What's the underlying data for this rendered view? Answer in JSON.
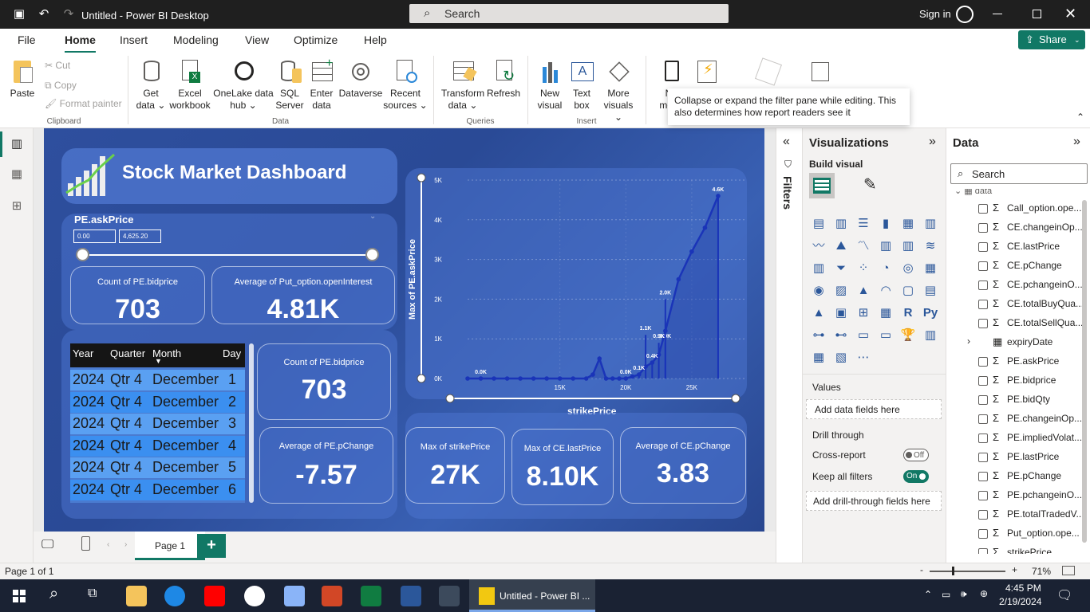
{
  "titlebar": {
    "title": "Untitled - Power BI Desktop",
    "search_placeholder": "Search",
    "signin": "Sign in"
  },
  "menu": {
    "tabs": [
      "File",
      "Home",
      "Insert",
      "Modeling",
      "View",
      "Optimize",
      "Help"
    ],
    "share": "Share"
  },
  "ribbon": {
    "paste": "Paste",
    "cut": "Cut",
    "copy": "Copy",
    "format_painter": "Format painter",
    "get_data": "Get",
    "get_data2": "data",
    "excel": "Excel",
    "excel2": "workbook",
    "onelake": "OneLake data",
    "onelake2": "hub",
    "sql": "SQL",
    "sql2": "Server",
    "enter": "Enter",
    "enter2": "data",
    "dataverse": "Dataverse",
    "recent": "Recent",
    "recent2": "sources",
    "transform": "Transform",
    "transform2": "data",
    "refresh": "Refresh",
    "new_visual": "New",
    "new_visual2": "visual",
    "text_box": "Text",
    "text_box2": "box",
    "more_visuals": "More",
    "more_visuals2": "visuals",
    "n_label": "N",
    "n_label2": "mea",
    "groups": {
      "clipboard": "Clipboard",
      "data": "Data",
      "queries": "Queries",
      "insert": "Insert"
    },
    "tooltip": "Collapse or expand the filter pane while editing. This also determines how report readers see it"
  },
  "report": {
    "title": "Stock Market Dashboard",
    "slicer": {
      "label": "PE.askPrice",
      "min": "0.00",
      "max": "4,625.20"
    },
    "cards": {
      "c1_label": "Count of PE.bidprice",
      "c1_value": "703",
      "c2_label": "Average of Put_option.openInterest",
      "c2_value": "4.81K",
      "c3_label": "Count of PE.bidprice",
      "c3_value": "703",
      "c4_label": "Average of PE.pChange",
      "c4_value": "-7.57",
      "c5_label": "Max of strikePrice",
      "c5_value": "27K",
      "c6_label": "Max of CE.lastPrice",
      "c6_value": "8.10K",
      "c7_label": "Average of CE.pChange",
      "c7_value": "3.83"
    },
    "table": {
      "headers": [
        "Year",
        "Quarter",
        "Month",
        "Day"
      ],
      "rows": [
        [
          "2024",
          "Qtr 4",
          "December",
          "1"
        ],
        [
          "2024",
          "Qtr 4",
          "December",
          "2"
        ],
        [
          "2024",
          "Qtr 4",
          "December",
          "3"
        ],
        [
          "2024",
          "Qtr 4",
          "December",
          "4"
        ],
        [
          "2024",
          "Qtr 4",
          "December",
          "5"
        ],
        [
          "2024",
          "Qtr 4",
          "December",
          "6"
        ]
      ]
    }
  },
  "chart_data": {
    "type": "line",
    "xlabel": "strikePrice",
    "ylabel": "Max of PE.askPrice",
    "x_ticks": [
      "15K",
      "20K",
      "25K"
    ],
    "y_ticks": [
      "0K",
      "1K",
      "2K",
      "3K",
      "4K",
      "5K"
    ],
    "xlim": [
      8000,
      29000
    ],
    "ylim": [
      0,
      5000
    ],
    "x": [
      8000,
      9000,
      10000,
      11000,
      12000,
      13000,
      14000,
      15000,
      16000,
      17000,
      17500,
      18000,
      18500,
      19000,
      19500,
      20000,
      20500,
      21000,
      21500,
      22000,
      22500,
      23000,
      24000,
      25000,
      26000,
      27000
    ],
    "y": [
      0,
      0,
      0,
      0,
      0,
      0,
      0,
      0,
      0,
      0,
      100,
      500,
      0,
      0,
      0,
      0,
      50,
      100,
      300,
      400,
      600,
      1200,
      2500,
      3200,
      3800,
      4600
    ],
    "data_labels": [
      {
        "x": 9000,
        "y": 0,
        "text": "0.0K"
      },
      {
        "x": 20000,
        "y": 0,
        "text": "0.0K"
      },
      {
        "x": 21000,
        "y": 100,
        "text": "0.1K"
      },
      {
        "x": 21500,
        "y": 1100,
        "text": "1.1K"
      },
      {
        "x": 22000,
        "y": 400,
        "text": "0.4K"
      },
      {
        "x": 22500,
        "y": 900,
        "text": "0.9K"
      },
      {
        "x": 23000,
        "y": 900,
        "text": "0.9K"
      },
      {
        "x": 23000,
        "y": 2000,
        "text": "2.0K"
      },
      {
        "x": 27000,
        "y": 4600,
        "text": "4.6K"
      }
    ]
  },
  "filters": {
    "label": "Filters"
  },
  "viz": {
    "title": "Visualizations",
    "build": "Build visual",
    "values": "Values",
    "add_fields": "Add data fields here",
    "drill": "Drill through",
    "cross": "Cross-report",
    "cross_state": "Off",
    "keep": "Keep all filters",
    "keep_state": "On",
    "add_drill": "Add drill-through fields here"
  },
  "data_pane": {
    "title": "Data",
    "search": "Search",
    "table": "data",
    "fields": [
      "Call_option.ope...",
      "CE.changeinOp...",
      "CE.lastPrice",
      "CE.pChange",
      "CE.pchangeinO...",
      "CE.totalBuyQua...",
      "CE.totalSellQua...",
      "expiryDate",
      "PE.askPrice",
      "PE.bidprice",
      "PE.bidQty",
      "PE.changeinOp...",
      "PE.impliedVolat...",
      "PE.lastPrice",
      "PE.pChange",
      "PE.pchangeinO...",
      "PE.totalTradedV...",
      "Put_option.ope...",
      "strikePrice"
    ]
  },
  "pages": {
    "current": "Page 1"
  },
  "status": {
    "page": "Page 1 of 1",
    "zoom": "71%"
  },
  "taskbar": {
    "app": "Untitled - Power BI ...",
    "time": "4:45 PM",
    "date": "2/19/2024"
  }
}
